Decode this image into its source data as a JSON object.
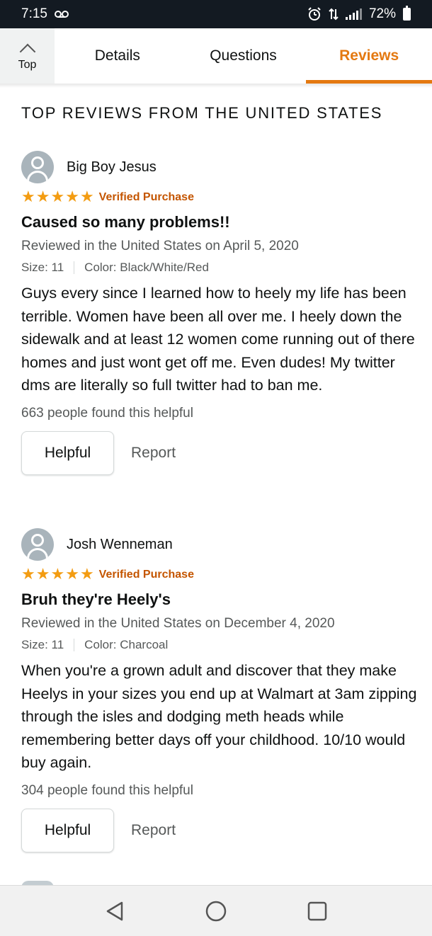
{
  "status_bar": {
    "time": "7:15",
    "voicemail_icon": "voicemail-icon",
    "battery": "72%"
  },
  "tabs": {
    "top_label": "Top",
    "items": [
      "Details",
      "Questions",
      "Reviews"
    ],
    "active": "Reviews"
  },
  "section_title": "TOP REVIEWS FROM THE UNITED STATES",
  "reviews": [
    {
      "reviewer": "Big Boy Jesus",
      "stars": 5,
      "verified": "Verified Purchase",
      "title": "Caused so many problems!!",
      "date": "Reviewed in the United States on April 5, 2020",
      "size": "Size: 11",
      "color": "Color: Black/White/Red",
      "body": "Guys every since I learned how to heely my life has been terrible. Women have been all over me. I heely down the sidewalk and at least 12 women come running out of there homes and just wont get off me. Even dudes! My twitter dms are literally so full twitter had to ban me.",
      "helpful_count": "663 people found this helpful",
      "helpful_label": "Helpful",
      "report_label": "Report"
    },
    {
      "reviewer": "Josh Wenneman",
      "stars": 5,
      "verified": "Verified Purchase",
      "title": "Bruh they're Heely's",
      "date": "Reviewed in the United States on December 4, 2020",
      "size": "Size: 11",
      "color": "Color: Charcoal",
      "body": "When you're a grown adult and discover that they make Heelys in your sizes you end up at Walmart at 3am zipping through the isles and dodging meth heads while remembering better days off your childhood. 10/10 would buy again.",
      "helpful_count": "304 people found this helpful",
      "helpful_label": "Helpful",
      "report_label": "Report"
    }
  ],
  "colors": {
    "accent": "#e47911",
    "star": "#f39c12",
    "verified": "#c45500",
    "status_bar_bg": "#131a22"
  }
}
